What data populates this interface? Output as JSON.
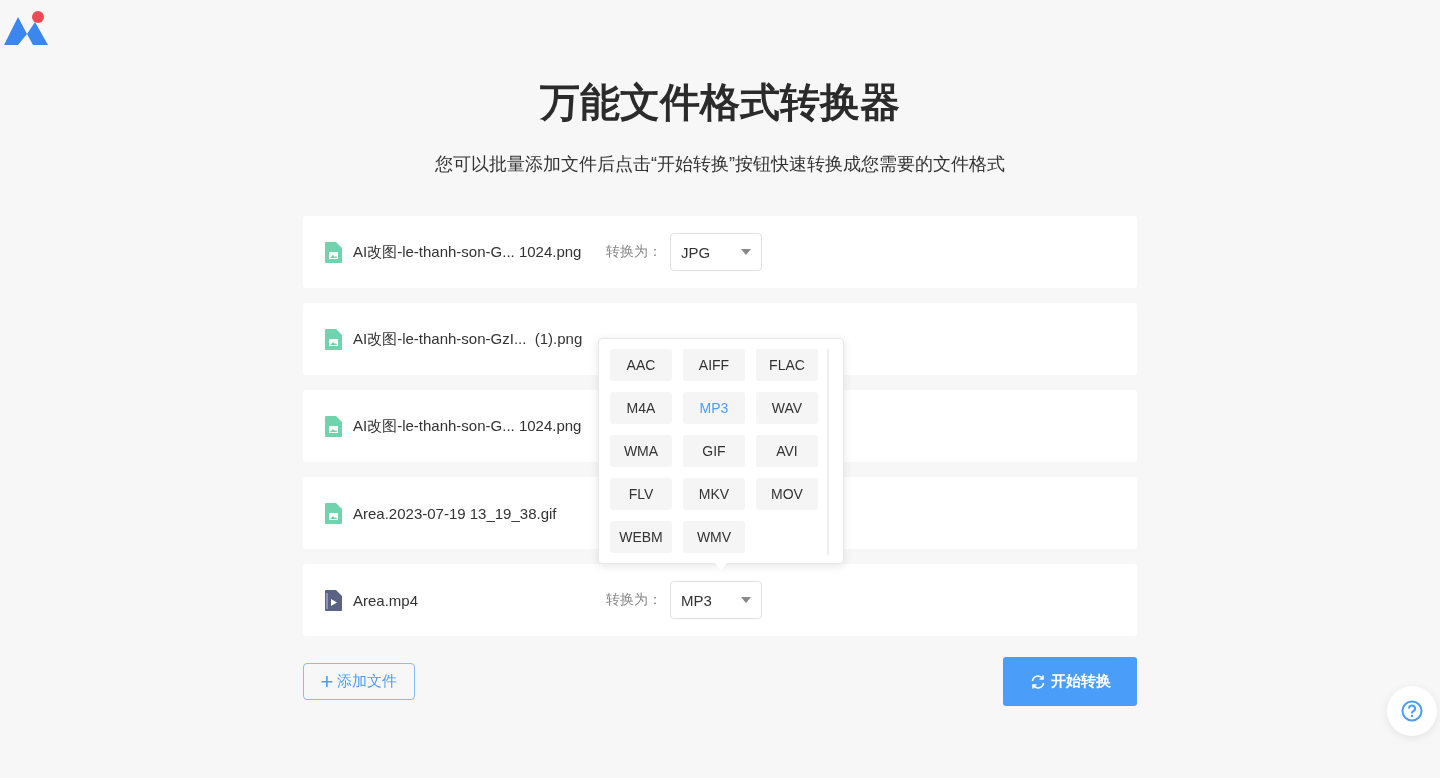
{
  "title": "万能文件格式转换器",
  "subtitle": "您可以批量添加文件后点击“开始转换”按钮快速转换成您需要的文件格式",
  "files": [
    {
      "kind": "image",
      "name": "AI改图-le-thanh-son-G... 1024.png",
      "label": "转换为：",
      "format": "JPG"
    },
    {
      "kind": "image",
      "name": "AI改图-le-thanh-son-GzI...  (1).png"
    },
    {
      "kind": "image",
      "name": "AI改图-le-thanh-son-G... 1024.png"
    },
    {
      "kind": "image",
      "name": "Area.2023-07-19 13_19_38.gif"
    },
    {
      "kind": "video",
      "name": "Area.mp4",
      "label": "转换为：",
      "format": "MP3"
    }
  ],
  "format_menu": {
    "options": [
      {
        "label": "AAC",
        "selected": false
      },
      {
        "label": "AIFF",
        "selected": false
      },
      {
        "label": "FLAC",
        "selected": false
      },
      {
        "label": "M4A",
        "selected": false
      },
      {
        "label": "MP3",
        "selected": true
      },
      {
        "label": "WAV",
        "selected": false
      },
      {
        "label": "WMA",
        "selected": false
      },
      {
        "label": "GIF",
        "selected": false
      },
      {
        "label": "AVI",
        "selected": false
      },
      {
        "label": "FLV",
        "selected": false
      },
      {
        "label": "MKV",
        "selected": false
      },
      {
        "label": "MOV",
        "selected": false
      },
      {
        "label": "WEBM",
        "selected": false
      },
      {
        "label": "WMV",
        "selected": false
      }
    ]
  },
  "add_button": {
    "icon": "+",
    "label": "添加文件"
  },
  "start_button": "开始转换"
}
